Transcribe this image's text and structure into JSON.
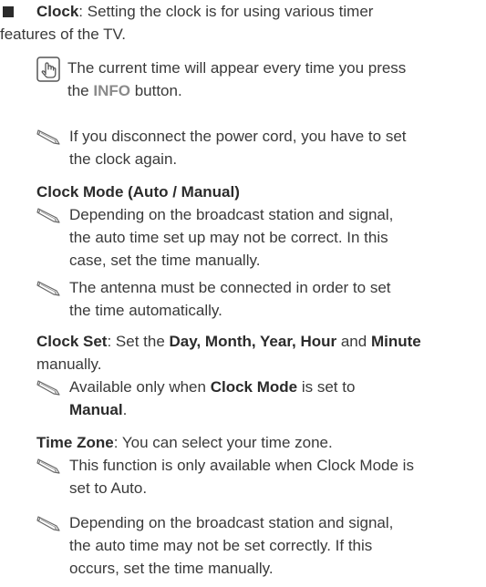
{
  "clock": {
    "term": "Clock",
    "desc_line1": ": Setting the clock is for using various timer",
    "desc_line2": "features of the TV.",
    "tip_line1": "The current time will appear every time you press",
    "tip_line2_pre": "the ",
    "tip_line2_key": "INFO",
    "tip_line2_post": " button.",
    "note_line1": "If you disconnect the power cord, you have to set",
    "note_line2": "the clock again."
  },
  "clock_mode": {
    "heading": "Clock Mode (Auto / Manual)",
    "note1_line1": "Depending on the broadcast station and signal,",
    "note1_line2": "the auto time set up may not be correct. In this",
    "note1_line3": "case, set the time manually.",
    "note2_line1": "The antenna must be connected in order to set",
    "note2_line2": "the time automatically."
  },
  "clock_set": {
    "term": "Clock Set",
    "desc_pre": ": Set the ",
    "desc_bold1": "Day, Month, Year, Hour",
    "desc_mid": " and ",
    "desc_bold2": "Minute",
    "desc_line2": "manually.",
    "note_pre": "Available only when ",
    "note_bold1": "Clock Mode",
    "note_mid": " is set to",
    "note_bold2": "Manual",
    "note_post": "."
  },
  "time_zone": {
    "term": "Time Zone",
    "desc": ": You can select your time zone.",
    "note1_line1": "This function is only available when Clock Mode is",
    "note1_line2": "set to Auto.",
    "note2_line1": "Depending on the broadcast station and signal,",
    "note2_line2": "the auto time may not be set correctly. If this",
    "note2_line3": "occurs, set the time manually."
  },
  "icons": {
    "bullet": "square-bullet-icon",
    "tip": "hand-touch-icon",
    "note": "pencil-note-icon"
  }
}
